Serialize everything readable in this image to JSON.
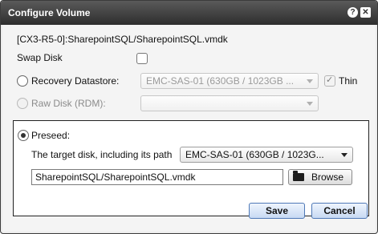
{
  "window": {
    "title": "Configure Volume",
    "help_glyph": "?",
    "close_glyph": "✕"
  },
  "disk_path": "[CX3-R5-0]:SharepointSQL/SharepointSQL.vmdk",
  "swap_disk": {
    "label": "Swap Disk",
    "checked": false
  },
  "recovery_datastore": {
    "label": "Recovery Datastore:",
    "selected": "EMC-SAS-01 (630GB / 1023GB ...",
    "thin_label": "Thin",
    "thin_checked": true
  },
  "raw_disk": {
    "label": "Raw Disk (RDM):",
    "selected": ""
  },
  "preseed": {
    "label": "Preseed:",
    "target_label": "The target disk, including its path",
    "target_selected": "EMC-SAS-01 (630GB / 1023G...",
    "path_value": "SharepointSQL/SharepointSQL.vmdk",
    "browse_label": "Browse"
  },
  "buttons": {
    "save": "Save",
    "cancel": "Cancel"
  }
}
